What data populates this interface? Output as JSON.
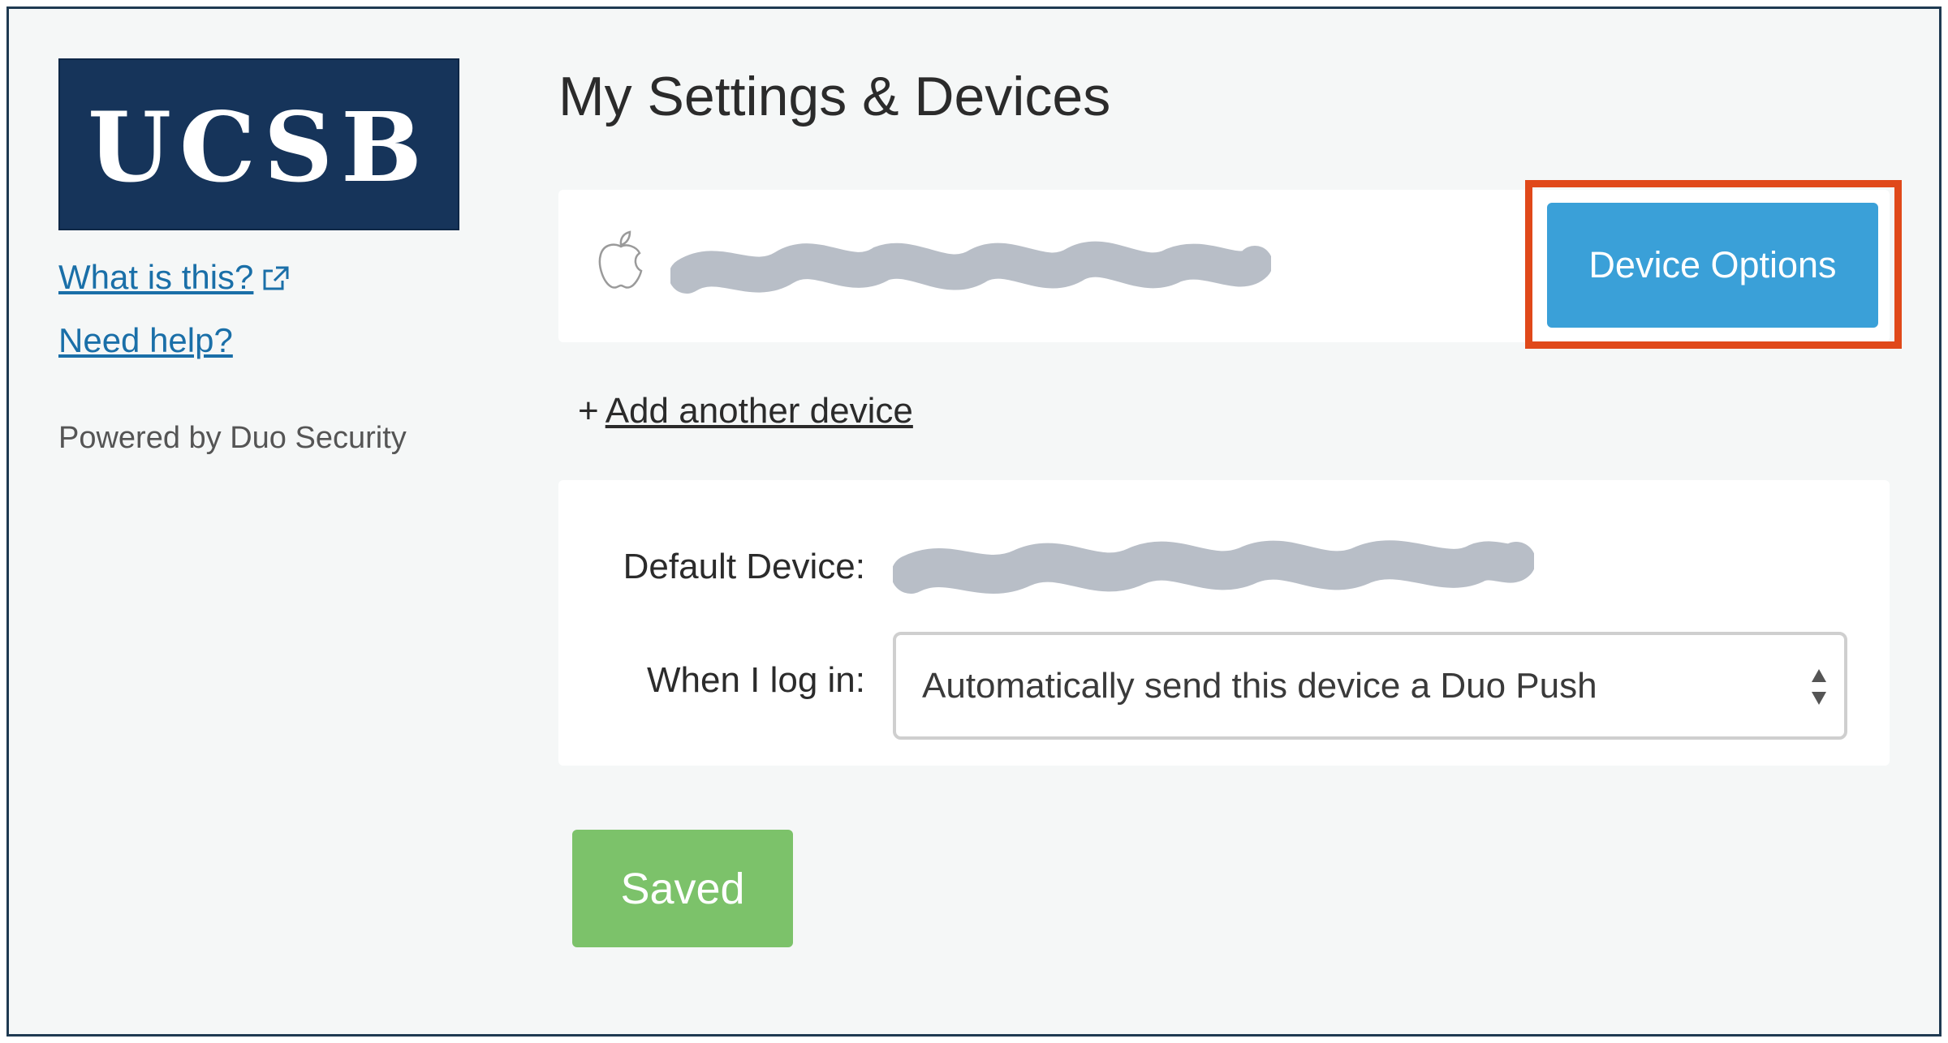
{
  "sidebar": {
    "logo_text": "UCSB",
    "what_is_this": "What is this?",
    "need_help": "Need help?",
    "powered_by": "Powered by Duo Security"
  },
  "main": {
    "title": "My Settings & Devices",
    "device": {
      "platform_icon": "apple-icon",
      "options_button": "Device Options"
    },
    "add_device": {
      "plus": "+",
      "label": "Add another device"
    },
    "settings": {
      "default_device_label": "Default Device:",
      "when_login_label": "When I log in:",
      "when_login_value": "Automatically send this device a Duo Push"
    },
    "saved_button": "Saved"
  },
  "colors": {
    "brand": "#16345a",
    "primary_button": "#3aa0d8",
    "saved_button": "#7cc26a",
    "highlight": "#e0491a",
    "link": "#1a6fa8"
  }
}
